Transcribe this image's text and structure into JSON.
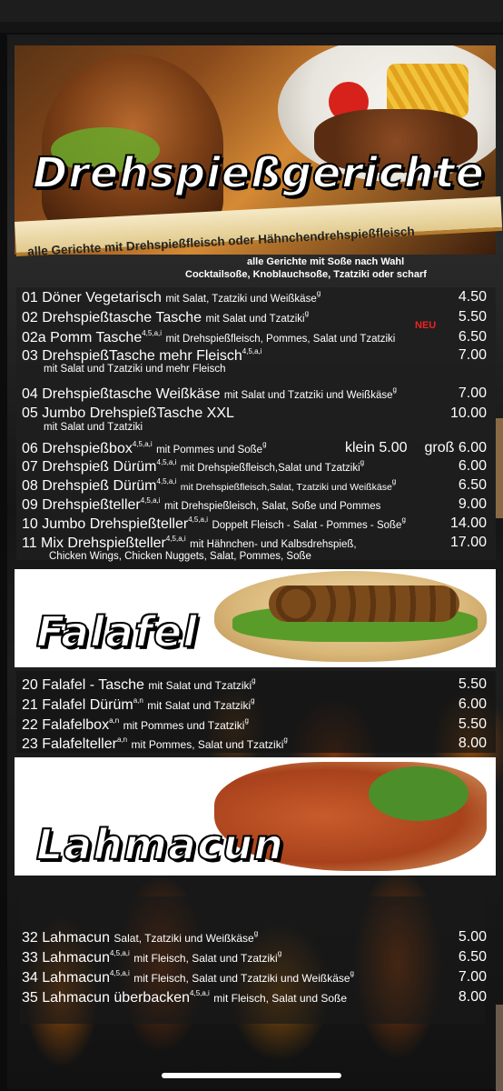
{
  "sections": {
    "drehspiess": {
      "title": "Drehspießgerichte",
      "banner": "alle Gerichte mit Drehspießfleisch oder Hähnchendrehspießfleisch",
      "sauce_line1": "alle Gerichte mit Soße nach Wahl",
      "sauce_line2": "Cocktailsoße, Knoblauchsoße, Tzatziki oder scharf",
      "neu": "NEU",
      "items": [
        {
          "name": "01 Döner Vegetarisch",
          "desc": "mit Salat, Tzatziki und Weißkäse",
          "price": "4.50"
        },
        {
          "name": "02 Drehspießtasche Tasche",
          "desc": "mit Salat und Tzatziki",
          "price": "5.50"
        },
        {
          "name": "02a Pomm Tasche",
          "desc": "mit Drehspießfleisch, Pommes, Salat und Tzatziki",
          "price": "6.50"
        },
        {
          "name": "03 DrehspießTasche mehr Fleisch",
          "desc": "mit Salat und Tzatziki und mehr Fleisch",
          "price": "7.00"
        },
        {
          "name": "04 Drehspießtasche Weißkäse",
          "desc": "mit Salat und Tzatziki und Weißkäse",
          "price": "7.00"
        },
        {
          "name": "05 Jumbo DrehspießTasche XXL",
          "desc": "mit Salat und Tzatziki",
          "price": "10.00"
        },
        {
          "name": "06 Drehspießbox",
          "desc": "mit Pommes und Soße",
          "price_klein": "klein 5.00",
          "price": "groß 6.00"
        },
        {
          "name": "07 Drehspieß Dürüm",
          "desc": "mit Drehspießfleisch,Salat und Tzatziki",
          "price": "6.00"
        },
        {
          "name": "08 Drehspieß Dürüm",
          "desc": "mit Drehspießfleisch,Salat, Tzatziki und Weißkäse",
          "price": "6.50"
        },
        {
          "name": "09 Drehspießteller",
          "desc": "mit Drehspießleisch, Salat, Soße und Pommes",
          "price": "9.00"
        },
        {
          "name": "10 Jumbo Drehspießteller",
          "desc": "Doppelt Fleisch - Salat - Pommes - Soße",
          "price": "14.00"
        },
        {
          "name": "11  Mix Drehspießteller",
          "desc": "mit Hähnchen- und Kalbsdrehspieß,",
          "desc2": "Chicken Wings, Chicken Nuggets, Salat, Pommes, Soße",
          "price": "17.00"
        }
      ]
    },
    "falafel": {
      "title": "Falafel",
      "items": [
        {
          "name": "20 Falafel - Tasche",
          "desc": "mit Salat und Tzatziki",
          "price": "5.50"
        },
        {
          "name": "21 Falafel Dürüm",
          "desc": "mit Salat und Tzatziki",
          "price": "6.00"
        },
        {
          "name": "22 Falafelbox",
          "desc": "mit Pommes und Tzatziki",
          "price": "5.50"
        },
        {
          "name": "23 Falafelteller",
          "desc": "mit Pommes, Salat und Tzatziki",
          "price": "8.00"
        }
      ]
    },
    "lahmacun": {
      "title": "Lahmacun",
      "items": [
        {
          "name": "32 Lahmacun",
          "desc": "Salat, Tzatziki und Weißkäse",
          "price": "5.00"
        },
        {
          "name": "33 Lahmacun",
          "desc": "mit Fleisch, Salat und Tzatziki",
          "price": "6.50"
        },
        {
          "name": "34 Lahmacun",
          "desc": "mit Fleisch, Salat und Tzatziki und Weißkäse",
          "price": "7.00"
        },
        {
          "name": "35 Lahmacun überbacken",
          "desc": "mit Fleisch, Salat und Soße",
          "price": "8.00"
        }
      ]
    }
  },
  "allergens": {
    "a": "g",
    "b": "4,5,a,i",
    "c": "a,n"
  },
  "colors": {
    "accent_red": "#e22222",
    "banner_gold": "#e1c98b"
  }
}
